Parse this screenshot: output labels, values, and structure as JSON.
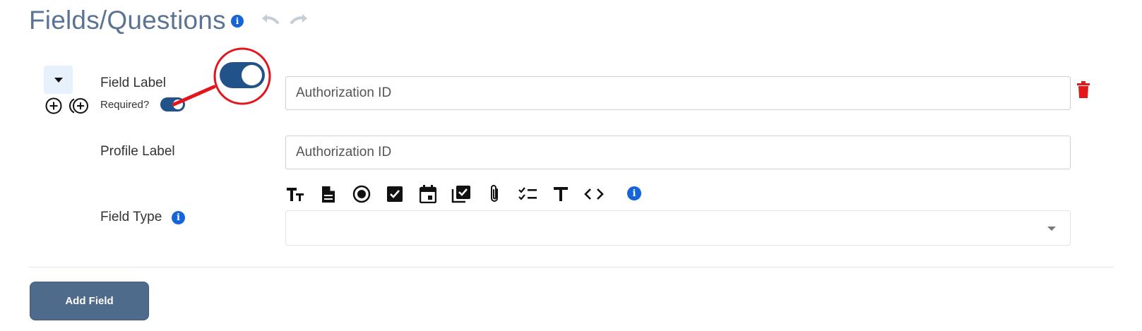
{
  "header": {
    "title": "Fields/Questions",
    "info_icon": "info-circle-icon",
    "undo_icon": "undo-icon",
    "redo_icon": "redo-icon"
  },
  "field": {
    "collapse_icon": "caret-down-icon",
    "add_above_icon": "circle-plus-icon",
    "add_below_icon": "circle-plus-alt-icon",
    "field_label": "Field Label",
    "field_label_value": "Authorization ID",
    "field_label_placeholder": "Authorization ID",
    "field_label_toggle_on": true,
    "required_label": "Required?",
    "required_on": true,
    "delete_icon": "trash-icon",
    "profile_label": "Profile Label",
    "profile_label_value": "Authorization ID",
    "profile_label_placeholder": "Authorization ID",
    "field_type_label": "Field Type",
    "field_type_value": "",
    "field_type_icons": [
      "text-size-icon",
      "document-icon",
      "radio-button-icon",
      "checkbox-icon",
      "calendar-icon",
      "multi-checkbox-icon",
      "attachment-icon",
      "checklist-icon",
      "title-text-icon",
      "code-icon"
    ]
  },
  "footer": {
    "add_field_label": "Add Field"
  },
  "colors": {
    "title": "#5b7493",
    "toggle": "#22528a",
    "info": "#1565d8",
    "delete": "#e11919",
    "button": "#4e6b8c",
    "annotation": "#e3141c",
    "collapse_bg": "#e7f1fb"
  }
}
